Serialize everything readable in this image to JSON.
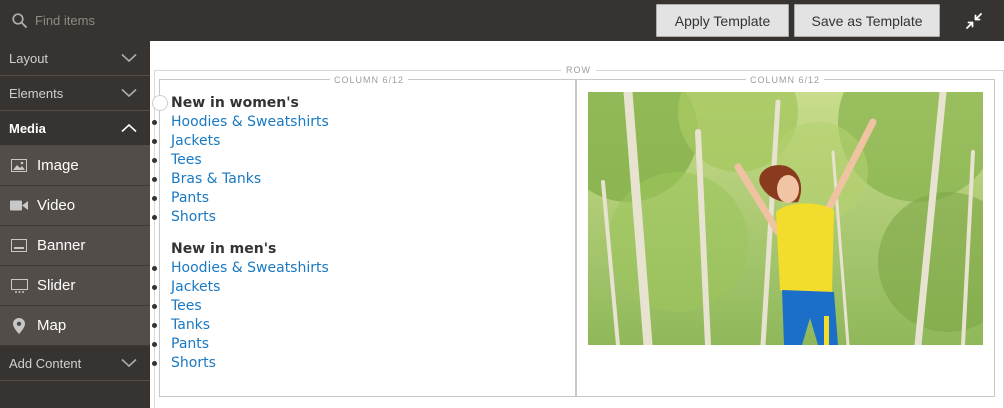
{
  "search": {
    "placeholder": "Find items"
  },
  "toolbar": {
    "apply_label": "Apply Template",
    "save_label": "Save as Template"
  },
  "sidebar": {
    "sections": [
      {
        "label": "Layout",
        "expanded": false
      },
      {
        "label": "Elements",
        "expanded": false
      },
      {
        "label": "Media",
        "expanded": true
      },
      {
        "label": "Add Content",
        "expanded": false
      }
    ],
    "media_items": [
      {
        "label": "Image",
        "icon": "image-icon"
      },
      {
        "label": "Video",
        "icon": "video-icon"
      },
      {
        "label": "Banner",
        "icon": "banner-icon"
      },
      {
        "label": "Slider",
        "icon": "slider-icon"
      },
      {
        "label": "Map",
        "icon": "map-pin-icon"
      }
    ]
  },
  "stage": {
    "row_label": "ROW",
    "columns": [
      {
        "label": "COLUMN 6/12"
      },
      {
        "label": "COLUMN 6/12"
      }
    ],
    "womens": {
      "heading": "New in women's",
      "links": [
        "Hoodies & Sweatshirts",
        "Jackets",
        "Tees",
        "Bras & Tanks",
        "Pants",
        "Shorts"
      ]
    },
    "mens": {
      "heading": "New in men's",
      "links": [
        "Hoodies & Sweatshirts",
        "Jackets",
        "Tees",
        "Tanks",
        "Pants",
        "Shorts"
      ]
    }
  },
  "colors": {
    "chrome_dark": "#373330",
    "sidebar_sub": "#524d49",
    "button_bg": "#e3e3e3",
    "link": "#1979c3",
    "text": "#333333"
  }
}
